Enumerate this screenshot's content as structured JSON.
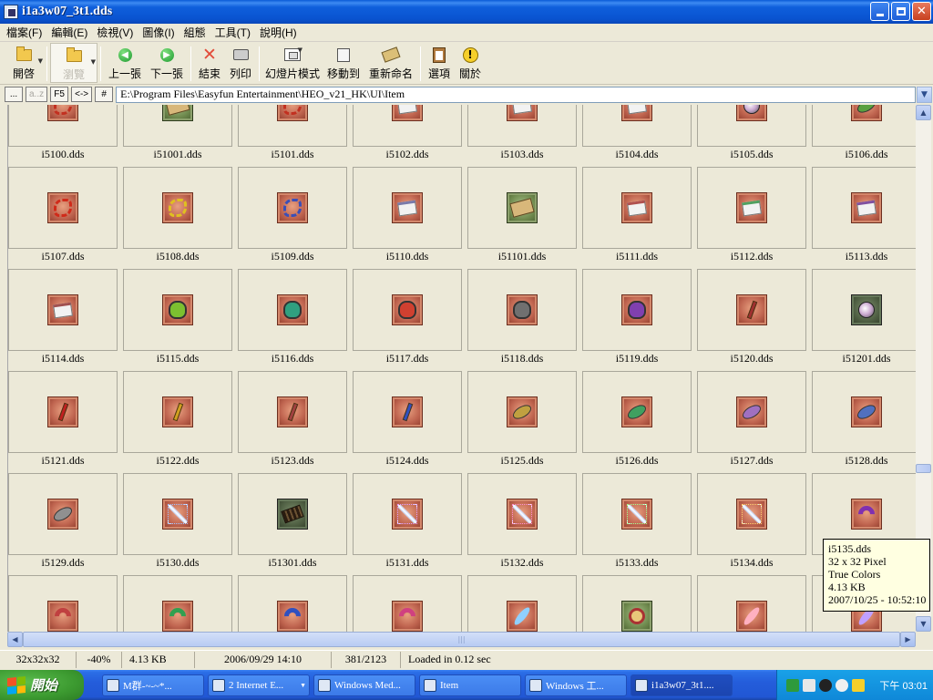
{
  "window": {
    "title": "i1a3w07_3t1.dds"
  },
  "menu": [
    "檔案(F)",
    "編輯(E)",
    "檢視(V)",
    "圖像(I)",
    "組態",
    "工具(T)",
    "說明(H)"
  ],
  "toolbar": {
    "open": "開啓",
    "browse": "瀏覽",
    "prev": "上一張",
    "next": "下一張",
    "close": "結束",
    "print": "列印",
    "slideshow": "幻燈片模式",
    "move_to": "移動到",
    "rename": "重新命名",
    "options": "選項",
    "about": "關於"
  },
  "addressbar": {
    "btn_dots": "...",
    "btn_az": "a..z",
    "btn_f5": "F5",
    "btn_swap": "<->",
    "btn_hash": "#",
    "path": "E:\\Program Files\\Easyfun Entertainment\\HEO_v21_HK\\UI\\Item"
  },
  "thumbnails": [
    {
      "name": "i5100.dds",
      "glyph": "rope",
      "color": "#c23020",
      "bg": "red"
    },
    {
      "name": "i51001.dds",
      "glyph": "scroll",
      "color": "#4f6f3a",
      "bg": "green"
    },
    {
      "name": "i5101.dds",
      "glyph": "rope",
      "color": "#c23020",
      "bg": "red"
    },
    {
      "name": "i5102.dds",
      "glyph": "book",
      "color": "#888888",
      "bg": "red"
    },
    {
      "name": "i5103.dds",
      "glyph": "book",
      "color": "#888888",
      "bg": "red"
    },
    {
      "name": "i5104.dds",
      "glyph": "book",
      "color": "#888888",
      "bg": "red"
    },
    {
      "name": "i5105.dds",
      "glyph": "bomb",
      "color": "#5a5a5a",
      "bg": "red"
    },
    {
      "name": "i5106.dds",
      "glyph": "leaf",
      "color": "#59a040",
      "bg": "red"
    },
    {
      "name": "i5107.dds",
      "glyph": "rope",
      "color": "#d02a1a",
      "bg": "red"
    },
    {
      "name": "i5108.dds",
      "glyph": "rope",
      "color": "#e0c020",
      "bg": "red"
    },
    {
      "name": "i5109.dds",
      "glyph": "rope",
      "color": "#3a4fb8",
      "bg": "red"
    },
    {
      "name": "i5110.dds",
      "glyph": "book",
      "color": "#7a7aaa",
      "bg": "red"
    },
    {
      "name": "i51101.dds",
      "glyph": "scroll",
      "color": "#4f6f3a",
      "bg": "green"
    },
    {
      "name": "i5111.dds",
      "glyph": "book",
      "color": "#b05050",
      "bg": "red"
    },
    {
      "name": "i5112.dds",
      "glyph": "book",
      "color": "#50a060",
      "bg": "red"
    },
    {
      "name": "i5113.dds",
      "glyph": "book",
      "color": "#8050a0",
      "bg": "red"
    },
    {
      "name": "i5114.dds",
      "glyph": "book",
      "color": "#a05050",
      "bg": "red"
    },
    {
      "name": "i5115.dds",
      "glyph": "frog",
      "color": "#7cc030",
      "bg": "red"
    },
    {
      "name": "i5116.dds",
      "glyph": "frog",
      "color": "#30a080",
      "bg": "red"
    },
    {
      "name": "i5117.dds",
      "glyph": "frog",
      "color": "#d04030",
      "bg": "red"
    },
    {
      "name": "i5118.dds",
      "glyph": "frog",
      "color": "#707070",
      "bg": "red"
    },
    {
      "name": "i5119.dds",
      "glyph": "frog",
      "color": "#8040b0",
      "bg": "red"
    },
    {
      "name": "i5120.dds",
      "glyph": "pen",
      "color": "#a03030",
      "bg": "red"
    },
    {
      "name": "i51201.dds",
      "glyph": "bomb",
      "color": "#c9a7cf",
      "bg": "dark"
    },
    {
      "name": "i5121.dds",
      "glyph": "pen",
      "color": "#c02020",
      "bg": "red"
    },
    {
      "name": "i5122.dds",
      "glyph": "pen",
      "color": "#d0a020",
      "bg": "red"
    },
    {
      "name": "i5123.dds",
      "glyph": "pen",
      "color": "#a04040",
      "bg": "red"
    },
    {
      "name": "i5124.dds",
      "glyph": "pen",
      "color": "#3050c0",
      "bg": "red"
    },
    {
      "name": "i5125.dds",
      "glyph": "leaf",
      "color": "#c0a040",
      "bg": "red"
    },
    {
      "name": "i5126.dds",
      "glyph": "leaf",
      "color": "#40a060",
      "bg": "red"
    },
    {
      "name": "i5127.dds",
      "glyph": "leaf",
      "color": "#a070c0",
      "bg": "red"
    },
    {
      "name": "i5128.dds",
      "glyph": "leaf",
      "color": "#5070c0",
      "bg": "red"
    },
    {
      "name": "i5129.dds",
      "glyph": "leaf",
      "color": "#909090",
      "bg": "red"
    },
    {
      "name": "i5130.dds",
      "glyph": "wand",
      "color": "#a0c0ff",
      "bg": "red"
    },
    {
      "name": "i51301.dds",
      "glyph": "sticks",
      "color": "#3a2a18",
      "bg": "dark"
    },
    {
      "name": "i5131.dds",
      "glyph": "wand",
      "color": "#e0a0ff",
      "bg": "red"
    },
    {
      "name": "i5132.dds",
      "glyph": "wand",
      "color": "#ff90d0",
      "bg": "red"
    },
    {
      "name": "i5133.dds",
      "glyph": "wand",
      "color": "#a0ff90",
      "bg": "red"
    },
    {
      "name": "i5134.dds",
      "glyph": "wand",
      "color": "#ffd070",
      "bg": "red"
    },
    {
      "name": "i5135.dds",
      "glyph": "shuriken",
      "color": "#8030b0",
      "bg": "red"
    },
    {
      "name": "",
      "glyph": "shuriken",
      "color": "#c04040",
      "bg": "red"
    },
    {
      "name": "",
      "glyph": "shuriken",
      "color": "#30a050",
      "bg": "red"
    },
    {
      "name": "",
      "glyph": "shuriken",
      "color": "#3050c0",
      "bg": "red"
    },
    {
      "name": "",
      "glyph": "shuriken",
      "color": "#d04080",
      "bg": "red"
    },
    {
      "name": "",
      "glyph": "feather",
      "color": "#90d0ff",
      "bg": "red"
    },
    {
      "name": "",
      "glyph": "scissors",
      "color": "#a03030",
      "bg": "green"
    },
    {
      "name": "",
      "glyph": "feather",
      "color": "#ffb0c0",
      "bg": "red"
    },
    {
      "name": "",
      "glyph": "feather",
      "color": "#c0a0ff",
      "bg": "red"
    }
  ],
  "tooltip": {
    "line1": "i5135.dds",
    "line2": "32 x 32 Pixel",
    "line3": "True Colors",
    "line4": "4.13 KB",
    "line5": "2007/10/25 - 10:52:10"
  },
  "statusbar": {
    "dims": "32x32x32",
    "zoom": "-40%",
    "size": "4.13 KB",
    "date": "2006/09/29 14:10",
    "index": "381/2123",
    "loaded": "Loaded in 0.12 sec"
  },
  "taskbar": {
    "start": "開始",
    "tasks": [
      {
        "label": "M群-~-~*...",
        "active": false,
        "dropdown": false
      },
      {
        "label": "2 Internet E...",
        "active": false,
        "dropdown": true
      },
      {
        "label": "Windows Med...",
        "active": false,
        "dropdown": false
      },
      {
        "label": "Item",
        "active": false,
        "dropdown": false
      },
      {
        "label": "Windows 工...",
        "active": false,
        "dropdown": false
      },
      {
        "label": "i1a3w07_3t1....",
        "active": true,
        "dropdown": false
      }
    ],
    "clock": "下午 03:01"
  },
  "colors": {
    "titlebar": "#0a5ad6",
    "chrome": "#ece9d8",
    "taskbar": "#245ddb",
    "start": "#3c9a30",
    "tooltip": "#ffffe1"
  }
}
